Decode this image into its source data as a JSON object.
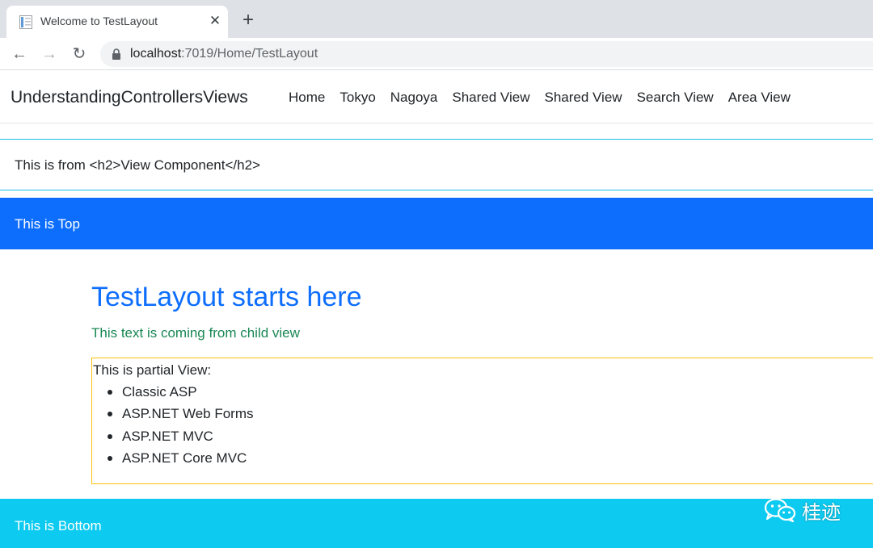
{
  "browser": {
    "tab_title": "Welcome to TestLayout",
    "url_host": "localhost",
    "url_path": ":7019/Home/TestLayout"
  },
  "navbar": {
    "brand": "UnderstandingControllersViews",
    "links": [
      "Home",
      "Tokyo",
      "Nagoya",
      "Shared View",
      "Shared View",
      "Search View",
      "Area View"
    ]
  },
  "view_component": {
    "text": "This is from <h2>View Component</h2>",
    "border_color": "#17c1e8"
  },
  "top_bar": {
    "text": "This is Top",
    "color": "#0d6efd"
  },
  "stray_mark": ";",
  "main": {
    "title": "TestLayout starts here",
    "child_text": "This text is coming from child view",
    "title_color": "#0d6efd",
    "child_text_color": "#198754"
  },
  "partial": {
    "heading": "This is partial View:",
    "items": [
      "Classic ASP",
      "ASP.NET Web Forms",
      "ASP.NET MVC",
      "ASP.NET Core MVC"
    ],
    "border_color": "#ffc107"
  },
  "bottom_bar": {
    "text": "This is Bottom",
    "color": "#0dcaf0"
  },
  "watermark": {
    "text": "桂迹"
  }
}
